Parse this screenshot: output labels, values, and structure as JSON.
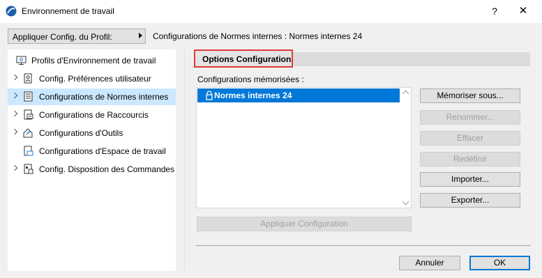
{
  "window": {
    "title": "Environnement de travail",
    "help_label": "?",
    "close_label": "✕"
  },
  "profile": {
    "button_label": "Appliquer Config. du Profil:",
    "status": "Configurations de Normes  internes :  Normes internes 24"
  },
  "sidebar": {
    "items": [
      {
        "label": "Profils d'Environnement de travail",
        "icon": "monitor-icon",
        "expandable": false,
        "selected": false
      },
      {
        "label": "Config. Préférences utilisateur",
        "icon": "user-preferences-icon",
        "expandable": true,
        "selected": false
      },
      {
        "label": "Configurations de Normes  internes",
        "icon": "standards-icon",
        "expandable": true,
        "selected": true
      },
      {
        "label": "Configurations de Raccourcis",
        "icon": "shortcuts-icon",
        "expandable": true,
        "selected": false
      },
      {
        "label": "Configurations d'Outils",
        "icon": "tools-icon",
        "expandable": true,
        "selected": false
      },
      {
        "label": "Configurations d'Espace de travail",
        "icon": "workspace-icon",
        "expandable": false,
        "selected": false
      },
      {
        "label": "Config. Disposition des Commandes",
        "icon": "command-layout-icon",
        "expandable": true,
        "selected": false
      }
    ]
  },
  "main": {
    "tab_label": "Options Configuration",
    "list_label": "Configurations mémorisées :",
    "list_items": [
      {
        "label": "Normes internes 24",
        "locked": true,
        "selected": true
      }
    ],
    "apply_label": "Appliquer Configuration",
    "buttons": {
      "save_as": "Mémoriser sous...",
      "rename": "Renommer...",
      "delete": "Effacer",
      "redefine": "Redéfinir",
      "import": "Importer...",
      "export": "Exporter..."
    }
  },
  "footer": {
    "cancel_label": "Annuler",
    "ok_label": "OK"
  },
  "colors": {
    "selection": "#0078d7",
    "sidebar_selection": "#cce8ff",
    "highlight_border": "#e53935"
  }
}
